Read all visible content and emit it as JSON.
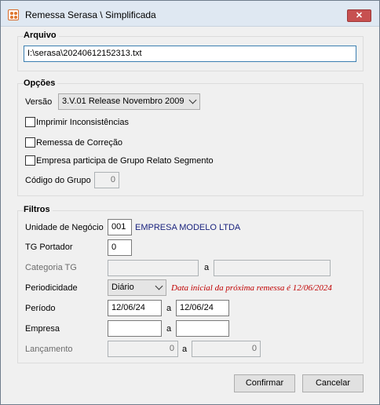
{
  "window": {
    "title": "Remessa Serasa \\ Simplificada",
    "close_glyph": "✕"
  },
  "arquivo": {
    "title": "Arquivo",
    "path": "I:\\serasa\\20240612152313.txt"
  },
  "opcoes": {
    "title": "Opções",
    "versao_label": "Versão",
    "versao_value": "3.V.01 Release Novembro 2009",
    "imprimir_label": "Imprimir Inconsistências",
    "imprimir_checked": false,
    "correcao_label": "Remessa de Correção",
    "correcao_checked": false,
    "grupo_label": "Empresa participa de Grupo Relato Segmento",
    "grupo_checked": false,
    "codigo_label": "Código do Grupo",
    "codigo_value": "0"
  },
  "filtros": {
    "title": "Filtros",
    "unidade_label": "Unidade de Negócio",
    "unidade_value": "001",
    "unidade_name": "EMPRESA MODELO LTDA",
    "portador_label": "TG Portador",
    "portador_value": "0",
    "categoria_label": "Categoria TG",
    "categoria_from": "",
    "categoria_to": "",
    "a_label": "a",
    "periodicidade_label": "Periodicidade",
    "periodicidade_value": "Diário",
    "periodicidade_note": "Data inicial da próxima remessa é 12/06/2024",
    "periodo_label": "Período",
    "periodo_from": "12/06/24",
    "periodo_to": "12/06/24",
    "empresa_label": "Empresa",
    "empresa_from": "",
    "empresa_to": "",
    "lancamento_label": "Lançamento",
    "lancamento_from": "0",
    "lancamento_to": "0"
  },
  "buttons": {
    "confirmar": "Confirmar",
    "cancelar": "Cancelar"
  },
  "colors": {
    "accent": "#3c7fb1",
    "warning": "#c00000",
    "company": "#1a237e"
  }
}
